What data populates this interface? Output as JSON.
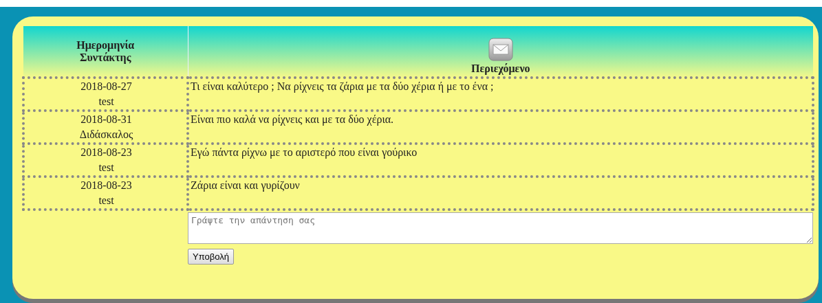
{
  "table": {
    "columns": [
      {
        "label": "Ημερομηνία Συντάκτης"
      },
      {
        "label": "Περιεχόμενο"
      }
    ],
    "rows": [
      {
        "date": "2018-08-27",
        "author": "test",
        "content": "Τι είναι καλύτερο ; Να ρίχνεις τα ζάρια με τα δύο χέρια ή με το ένα ;"
      },
      {
        "date": "2018-08-31",
        "author": "Διδάσκαλος",
        "content": "Είναι πιο καλά να ρίχνεις και με τα δύο χέρια."
      },
      {
        "date": "2018-08-23",
        "author": "test",
        "content": "Εγώ πάντα ρίχνω με το αριστερό που είναι γούρικο"
      },
      {
        "date": "2018-08-23",
        "author": "test",
        "content": "Ζάρια είναι και γυρίζουν"
      }
    ]
  },
  "reply": {
    "placeholder": "Γράψτε την απάντηση σας",
    "submit": "Υποβολή"
  }
}
